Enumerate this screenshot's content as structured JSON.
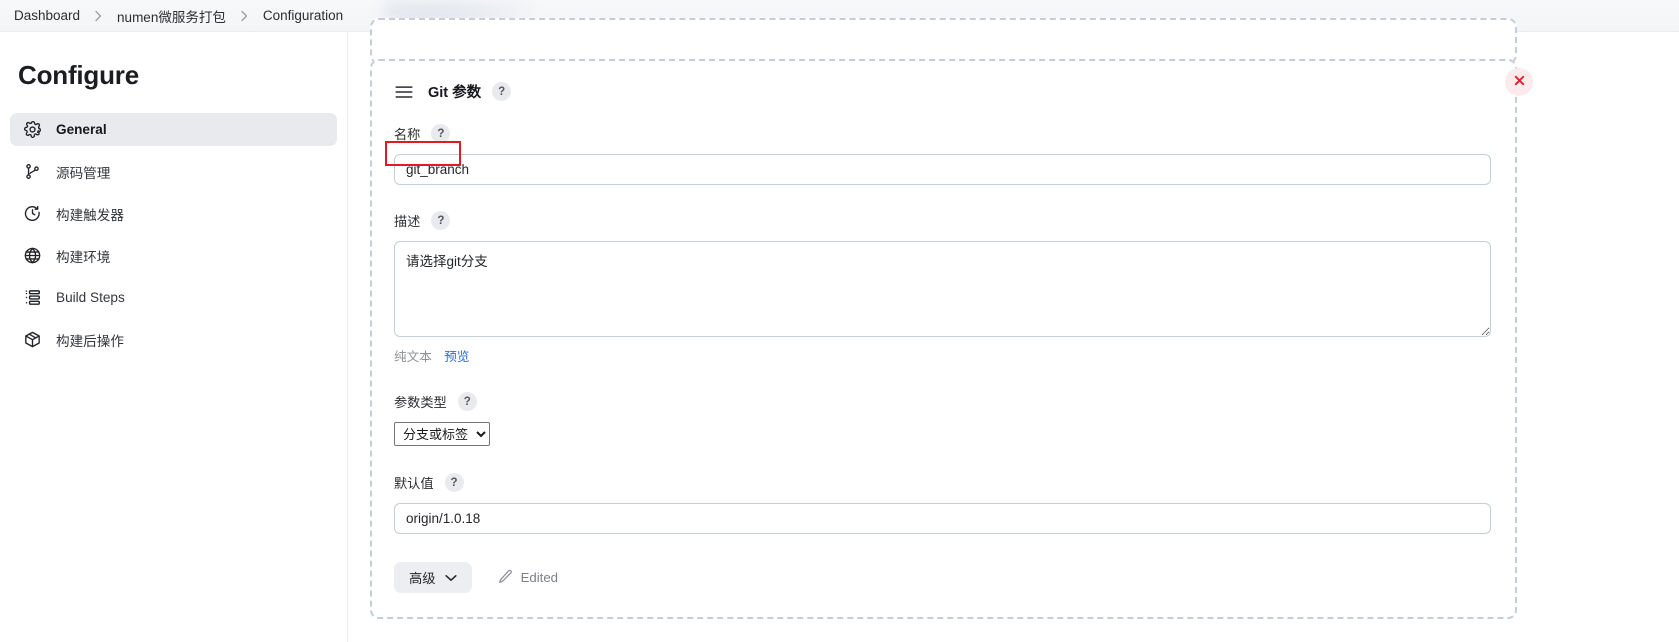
{
  "breadcrumb": {
    "items": [
      {
        "label": "Dashboard"
      },
      {
        "label": "numen微服务打包"
      },
      {
        "label": "Configuration"
      }
    ]
  },
  "sidebar": {
    "title": "Configure",
    "items": [
      {
        "label": "General",
        "icon": "gear-icon",
        "active": true
      },
      {
        "label": "源码管理",
        "icon": "branch-icon",
        "active": false
      },
      {
        "label": "构建触发器",
        "icon": "clock-icon",
        "active": false
      },
      {
        "label": "构建环境",
        "icon": "globe-icon",
        "active": false
      },
      {
        "label": "Build Steps",
        "icon": "list-icon",
        "active": false
      },
      {
        "label": "构建后操作",
        "icon": "package-icon",
        "active": false
      }
    ]
  },
  "panel": {
    "title": "Git 参数",
    "drag_handle_icon": "hamburger-drag-icon",
    "help_badge": "?",
    "close_icon": "close-x-icon",
    "fields": {
      "name": {
        "label": "名称",
        "help": "?",
        "value": "git_branch",
        "placeholder": ""
      },
      "description": {
        "label": "描述",
        "help": "?",
        "value": "请选择git分支",
        "placeholder": ""
      },
      "description_links": {
        "plain_text": "纯文本",
        "preview": "预览"
      },
      "param_type": {
        "label": "参数类型",
        "help": "?",
        "selected": "分支或标签",
        "options": [
          "分支或标签"
        ]
      },
      "default_value": {
        "label": "默认值",
        "help": "?",
        "value": "origin/1.0.18",
        "placeholder": ""
      }
    },
    "footer": {
      "advanced_label": "高级",
      "advanced_icon": "chevron-down-icon",
      "edited_label": "Edited",
      "edited_icon": "pencil-icon"
    }
  },
  "colors": {
    "annotation_red": "#e01b24",
    "link_blue": "#2a6ad4",
    "close_red": "#e8212f",
    "close_bg": "#fdeaec",
    "active_bg": "#e9eaed",
    "dashed_border": "#c5cdd6"
  }
}
